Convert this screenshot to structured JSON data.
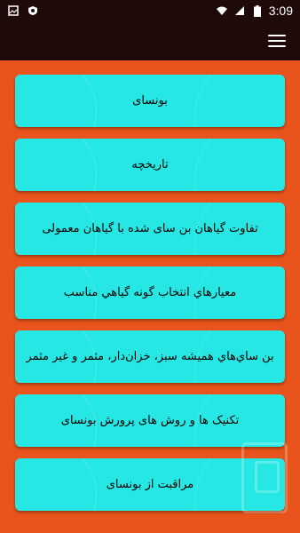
{
  "status_bar": {
    "time": "3:09",
    "left_icons": [
      "image-icon",
      "shield-icon"
    ],
    "right_icons": [
      "wifi-icon",
      "signal-icon",
      "battery-icon"
    ]
  },
  "app_bar": {
    "menu_icon": "hamburger-menu-icon"
  },
  "colors": {
    "background": "#e8541b",
    "bar": "#1f0a0a",
    "card": "#26e7e3"
  },
  "items": [
    {
      "label": "بونسای"
    },
    {
      "label": "تاریخچه"
    },
    {
      "label": "تفاوت گیاهان بن سای شده با گیاهان معمولی"
    },
    {
      "label": "معيارهاي انتخاب گونه گياهي مناسب"
    },
    {
      "label": "بن ساي‌هاي هميشه سبز، خزان‌دار، مثمر و غير مثمر"
    },
    {
      "label": "تکنیک ها و روش های پرورش بونسای"
    },
    {
      "label": "مراقبت از بونسای"
    }
  ]
}
